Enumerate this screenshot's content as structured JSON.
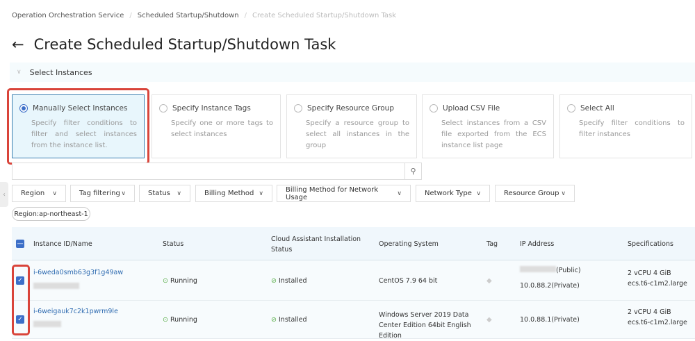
{
  "breadcrumb": [
    "Operation Orchestration Service",
    "Scheduled Startup/Shutdown",
    "Create Scheduled Startup/Shutdown Task"
  ],
  "title": "Create Scheduled Startup/Shutdown Task",
  "section": "Select Instances",
  "options": [
    {
      "label": "Manually Select Instances",
      "desc": "Specify filter conditions to filter and select instances from the instance list.",
      "selected": true
    },
    {
      "label": "Specify Instance Tags",
      "desc": "Specify one or more tags to select instances",
      "selected": false
    },
    {
      "label": "Specify Resource Group",
      "desc": "Specify a resource group to select all instances in the group",
      "selected": false
    },
    {
      "label": "Upload CSV File",
      "desc": "Select instances from a CSV file exported from the ECS instance list page",
      "selected": false
    },
    {
      "label": "Select All",
      "desc": "Specify filter conditions to filter instances",
      "selected": false
    }
  ],
  "search": {
    "placeholder": "",
    "icon": "search-icon"
  },
  "filters": [
    "Region",
    "Tag filtering",
    "Status",
    "Billing Method",
    "Billing Method for Network Usage",
    "Network Type",
    "Resource Group"
  ],
  "active_filter": "Region:ap-northeast-1",
  "table": {
    "columns": [
      "Instance ID/Name",
      "Status",
      "Cloud Assistant Installation Status",
      "Operating System",
      "Tag",
      "IP Address",
      "Specifications"
    ],
    "rows": [
      {
        "id": "i-6weda0smb63g3f1g49aw",
        "status": "Running",
        "assistant": "Installed",
        "os": "CentOS 7.9 64 bit",
        "ip_public": "(Public)",
        "ip_private": "10.0.88.2(Private)",
        "spec1": "2 vCPU 4 GiB",
        "spec2": "ecs.t6-c1m2.large",
        "checked": true
      },
      {
        "id": "i-6weigauk7c2k1pwrm9le",
        "status": "Running",
        "assistant": "Installed",
        "os": "Windows Server 2019 Data Center Edition 64bit English Edition",
        "ip_private": "10.0.88.1(Private)",
        "spec1": "2 vCPU 4 GiB",
        "spec2": "ecs.t6-c1m2.large",
        "checked": true
      }
    ]
  },
  "colors": {
    "accent": "#3c6fc8",
    "highlight": "#d9443a",
    "success": "#5aae4a"
  }
}
